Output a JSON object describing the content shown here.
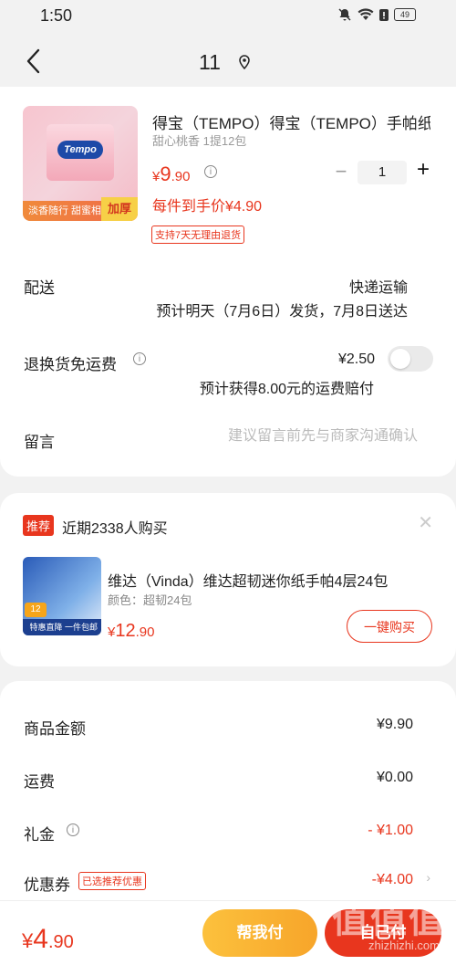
{
  "status_bar": {
    "time": "1:50",
    "battery": "49"
  },
  "header": {
    "title": "11"
  },
  "product": {
    "title": "得宝（TEMPO）得宝（TEMPO）手帕纸",
    "spec": "甜心桃香 1提12包",
    "price_currency": "¥",
    "price_int": "9",
    "price_dec": ".90",
    "quantity": "1",
    "unit_price_label": "每件到手价¥4.90",
    "return_tag": "支持7天无理由退货",
    "image": {
      "brand": "Tempo",
      "badge_left": "淡香随行 甜蜜相伴",
      "badge_right": "加厚"
    }
  },
  "shipping": {
    "label": "配送",
    "method": "快递运输",
    "eta": "预计明天（7月6日）发货，7月8日送达"
  },
  "insurance": {
    "label": "退换货免运费",
    "price": "¥2.50",
    "note": "预计获得8.00元的运费赔付",
    "enabled": false
  },
  "message": {
    "label": "留言",
    "placeholder": "建议留言前先与商家沟通确认"
  },
  "recommend": {
    "tag": "推荐",
    "title": "近期2338人购买",
    "item_name": "维达（Vinda）维达超韧迷你纸手帕4层24包",
    "item_spec": "颜色：超韧24包",
    "price_currency": "¥",
    "price_int": "12",
    "price_dec": ".90",
    "buy_label": "一键购买",
    "image_badge": "12",
    "image_footer": "特惠直降 一件包邮"
  },
  "summary": {
    "goods_label": "商品金额",
    "goods_value": "¥9.90",
    "freight_label": "运费",
    "freight_value": "¥0.00",
    "gift_label": "礼金",
    "gift_value": "- ¥1.00",
    "coupon_label": "优惠券",
    "coupon_tag": "已选推荐优惠",
    "coupon_value": "-¥4.00"
  },
  "bottom": {
    "total_currency": "¥",
    "total_int": "4",
    "total_dec": ".90",
    "help_pay": "帮我付",
    "self_pay": "自己付"
  },
  "watermark": {
    "main": "值值值",
    "sub": "zhizhizhi.com"
  },
  "colors": {
    "accent": "#e8361e",
    "help_button": "#f9b232"
  }
}
